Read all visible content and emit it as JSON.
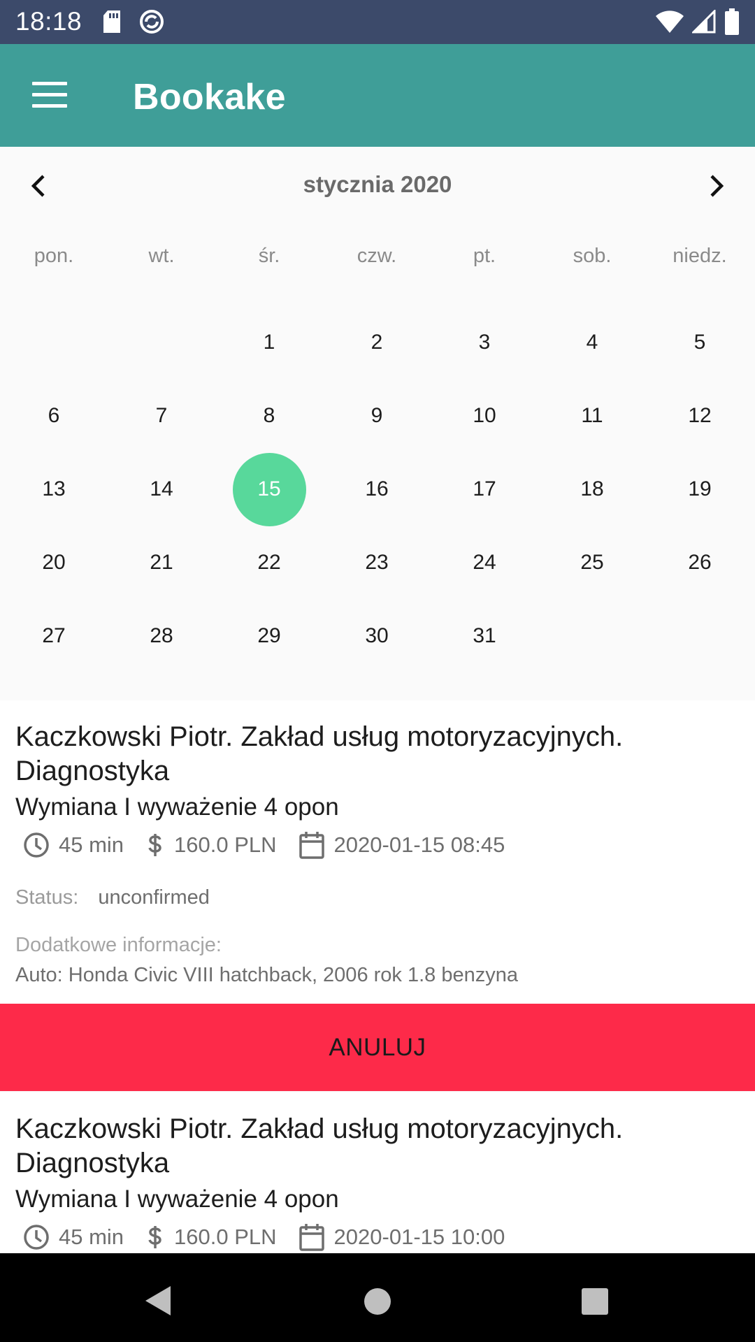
{
  "status_bar": {
    "time": "18:18"
  },
  "app_bar": {
    "title": "Bookake"
  },
  "calendar": {
    "month_label": "stycznia 2020",
    "weekdays": [
      "pon.",
      "wt.",
      "śr.",
      "czw.",
      "pt.",
      "sob.",
      "niedz."
    ],
    "leading_blanks": 2,
    "days": [
      "1",
      "2",
      "3",
      "4",
      "5",
      "6",
      "7",
      "8",
      "9",
      "10",
      "11",
      "12",
      "13",
      "14",
      "15",
      "16",
      "17",
      "18",
      "19",
      "20",
      "21",
      "22",
      "23",
      "24",
      "25",
      "26",
      "27",
      "28",
      "29",
      "30",
      "31"
    ],
    "selected_day": "15",
    "selected_color": "#58d89b"
  },
  "bookings": [
    {
      "provider": "Kaczkowski Piotr. Zakład usług motoryzacyjnych. Diagnostyka",
      "service": "Wymiana I wyważenie 4 opon",
      "duration": "45 min",
      "price": "160.0 PLN",
      "datetime": "2020-01-15 08:45",
      "status_label": "Status:",
      "status_value": "unconfirmed",
      "info_label": "Dodatkowe informacje:",
      "info_text": "Auto: Honda Civic VIII hatchback, 2006 rok 1.8 benzyna",
      "cancel_label": "ANULUJ"
    },
    {
      "provider": "Kaczkowski Piotr. Zakład usług motoryzacyjnych. Diagnostyka",
      "service": "Wymiana I wyważenie 4 opon",
      "duration": "45 min",
      "price": "160.0 PLN",
      "datetime": "2020-01-15 10:00"
    }
  ],
  "colors": {
    "status_bar": "#3c4a6a",
    "app_bar": "#3f9e98",
    "cancel_button": "#fd2a49"
  }
}
